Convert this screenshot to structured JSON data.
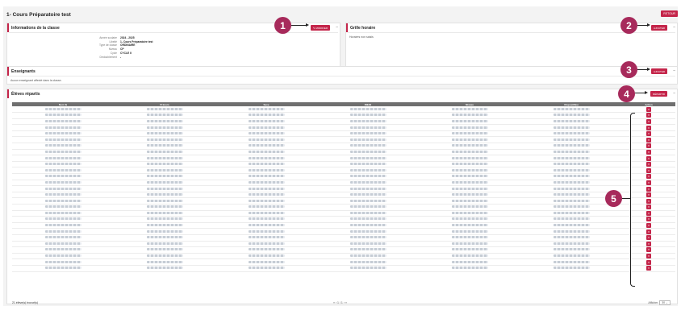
{
  "page": {
    "title": "1- Cours Préparatoire test",
    "retour_label": "RETOUR"
  },
  "info": {
    "title": "Informations de la classe",
    "modify_label": "MODIFIER",
    "collapse": "–",
    "rows": [
      {
        "label": "Année scolaire",
        "value": "2024 - 2025"
      },
      {
        "label": "Libellé",
        "value": "1- Cours Préparatoire test"
      },
      {
        "label": "Type de classe",
        "value": "ORDINAIRE"
      },
      {
        "label": "Niveau",
        "value": "CP"
      },
      {
        "label": "Cycle",
        "value": "CYCLE II"
      },
      {
        "label": "Dédoublement",
        "value": "-"
      }
    ]
  },
  "grille": {
    "title": "Grille horaire",
    "add_label": "AJOUTER",
    "collapse": "–",
    "empty_text": "Horaires non saisis"
  },
  "enseignants": {
    "title": "Enseignants",
    "add_label": "AJOUTER",
    "collapse": "–",
    "empty_text": "Aucun enseignant affecté dans la classe."
  },
  "eleves": {
    "title": "Élèves répartis",
    "repartir_label": "RÉPARTIR",
    "collapse": "–",
    "columns": [
      "Nom ⇅",
      "Prénom",
      "Sexe",
      "INE/Id",
      "Niveau",
      "Dispositif(s)",
      "Action"
    ],
    "row_count": 27,
    "count_text": "21 élève(s) trouvé(s)",
    "pager_text": "«   ‹   1 / 1   ›   »",
    "afficher_label": "Afficher",
    "afficher_value": "30 ⌄"
  },
  "annotations": [
    "1",
    "2",
    "3",
    "4",
    "5"
  ],
  "colors": {
    "accent": "#c4254a",
    "badge": "#a72a5b",
    "header": "#6f6f6f"
  }
}
